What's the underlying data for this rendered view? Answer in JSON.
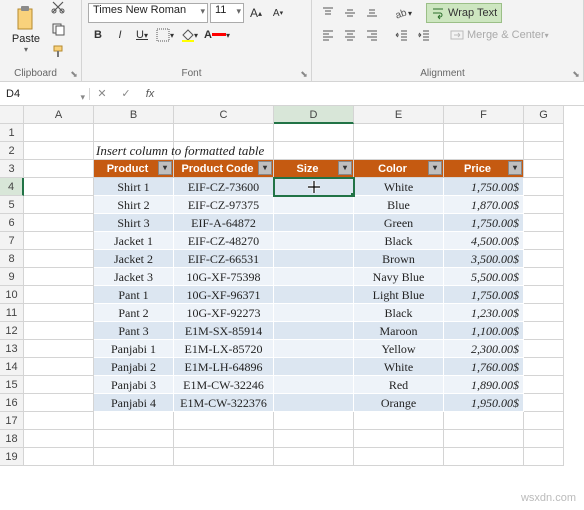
{
  "ribbon": {
    "groups": {
      "clipboard": {
        "label": "Clipboard",
        "paste": "Paste"
      },
      "font": {
        "label": "Font",
        "font_name": "Times New Roman",
        "font_size": "11",
        "bold": "B",
        "italic": "I",
        "underline": "U"
      },
      "alignment": {
        "label": "Alignment",
        "wrap": "Wrap Text",
        "merge": "Merge & Center"
      }
    }
  },
  "formula_bar": {
    "namebox": "D4",
    "formula": ""
  },
  "columns": [
    "A",
    "B",
    "C",
    "D",
    "E",
    "F",
    "G"
  ],
  "active_col": "D",
  "active_row": "4",
  "title_cell": "Insert column to formatted table",
  "headers": [
    "Product",
    "Product Code",
    "Size",
    "Color",
    "Price"
  ],
  "rows": [
    {
      "r": "4",
      "p": "Shirt 1",
      "c": "EIF-CZ-73600",
      "s": "",
      "col": "White",
      "pr": "1,750.00$"
    },
    {
      "r": "5",
      "p": "Shirt 2",
      "c": "EIF-CZ-97375",
      "s": "",
      "col": "Blue",
      "pr": "1,870.00$"
    },
    {
      "r": "6",
      "p": "Shirt 3",
      "c": "EIF-A-64872",
      "s": "",
      "col": "Green",
      "pr": "1,750.00$"
    },
    {
      "r": "7",
      "p": "Jacket 1",
      "c": "EIF-CZ-48270",
      "s": "",
      "col": "Black",
      "pr": "4,500.00$"
    },
    {
      "r": "8",
      "p": "Jacket 2",
      "c": "EIF-CZ-66531",
      "s": "",
      "col": "Brown",
      "pr": "3,500.00$"
    },
    {
      "r": "9",
      "p": "Jacket 3",
      "c": "10G-XF-75398",
      "s": "",
      "col": "Navy Blue",
      "pr": "5,500.00$"
    },
    {
      "r": "10",
      "p": "Pant 1",
      "c": "10G-XF-96371",
      "s": "",
      "col": "Light Blue",
      "pr": "1,750.00$"
    },
    {
      "r": "11",
      "p": "Pant 2",
      "c": "10G-XF-92273",
      "s": "",
      "col": "Black",
      "pr": "1,230.00$"
    },
    {
      "r": "12",
      "p": "Pant 3",
      "c": "E1M-SX-85914",
      "s": "",
      "col": "Maroon",
      "pr": "1,100.00$"
    },
    {
      "r": "13",
      "p": "Panjabi 1",
      "c": "E1M-LX-85720",
      "s": "",
      "col": "Yellow",
      "pr": "2,300.00$"
    },
    {
      "r": "14",
      "p": "Panjabi 2",
      "c": "E1M-LH-64896",
      "s": "",
      "col": "White",
      "pr": "1,760.00$"
    },
    {
      "r": "15",
      "p": "Panjabi 3",
      "c": "E1M-CW-32246",
      "s": "",
      "col": "Red",
      "pr": "1,890.00$"
    },
    {
      "r": "16",
      "p": "Panjabi 4",
      "c": "E1M-CW-322376",
      "s": "",
      "col": "Orange",
      "pr": "1,950.00$"
    }
  ],
  "watermark": "wsxdn.com"
}
